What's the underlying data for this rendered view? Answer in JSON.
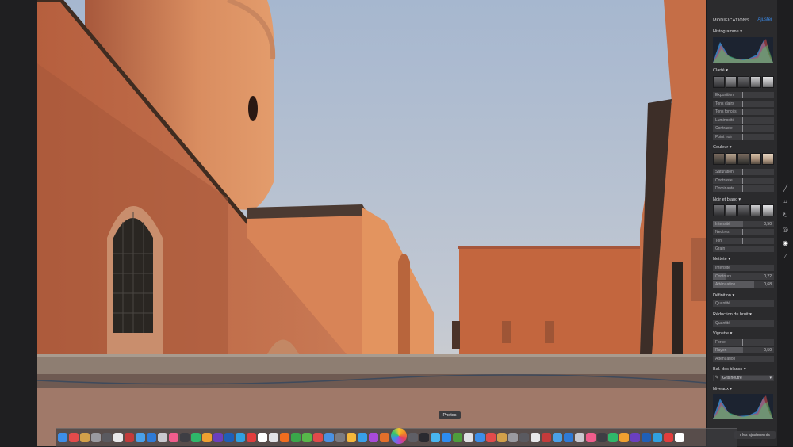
{
  "panel": {
    "title": "MODIFICATIONS",
    "adjust_label": "Ajuster",
    "sections": {
      "histogram": "Histogramme ▾",
      "clarte": "Clarté ▾",
      "couleur": "Couleur ▾",
      "noir_blanc": "Noir et blanc ▾",
      "nettete": "Netteté ▾",
      "definition": "Définition ▾",
      "bruit": "Réduction du bruit ▾",
      "vignette": "Vignette ▾",
      "balance": "Bal. des blancs ▾",
      "niveaux": "Niveaux ▾"
    },
    "clarte_sliders": [
      {
        "label": "Exposition",
        "value": ""
      },
      {
        "label": "Tons clairs",
        "value": ""
      },
      {
        "label": "Tons foncés",
        "value": ""
      },
      {
        "label": "Luminosité",
        "value": ""
      },
      {
        "label": "Contraste",
        "value": ""
      },
      {
        "label": "Point noir",
        "value": ""
      }
    ],
    "couleur_sliders": [
      {
        "label": "Saturation",
        "value": ""
      },
      {
        "label": "Contraste",
        "value": ""
      },
      {
        "label": "Dominante",
        "value": ""
      }
    ],
    "nb_sliders": [
      {
        "label": "Intensité",
        "value": "0,50"
      },
      {
        "label": "Neutres",
        "value": ""
      },
      {
        "label": "Ton",
        "value": ""
      },
      {
        "label": "Grain",
        "value": ""
      }
    ],
    "nettete_sliders": [
      {
        "label": "Intensité",
        "value": ""
      },
      {
        "label": "Contours",
        "value": "0,22"
      },
      {
        "label": "Atténuation",
        "value": "0,68"
      }
    ],
    "definition_slider": {
      "label": "Quantité",
      "value": ""
    },
    "bruit_slider": {
      "label": "Quantité",
      "value": ""
    },
    "vignette_sliders": [
      {
        "label": "Force",
        "value": ""
      },
      {
        "label": "Rayon",
        "value": "0,50"
      },
      {
        "label": "Atténuation",
        "value": ""
      }
    ],
    "balance_select": "Gris neutre",
    "reset_label": "r les ajustements"
  },
  "tools": {
    "icons": [
      "wand-icon",
      "crop-icon",
      "rotate-icon",
      "filter-icon",
      "adjust-icon",
      "bandage-icon"
    ]
  },
  "dock": {
    "tooltip": "Photos"
  },
  "colors": {
    "accent": "#3b8bea",
    "panel_bg": "#2b2b2d"
  }
}
